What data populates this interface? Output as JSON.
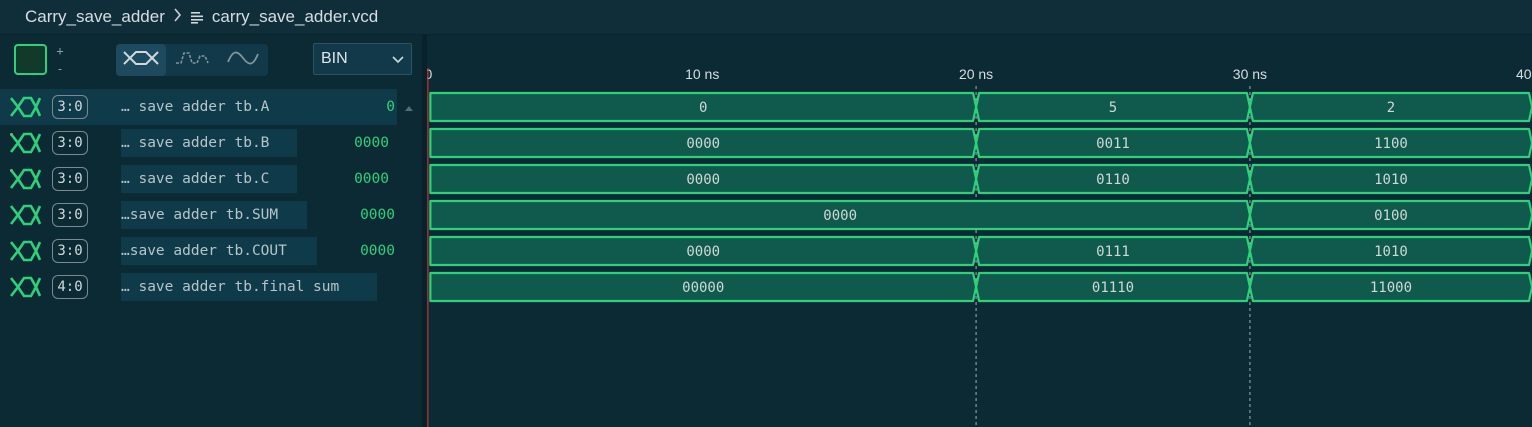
{
  "breadcrumb": {
    "root": "Carry_save_adder",
    "file": "carry_save_adder.vcd"
  },
  "toolbar": {
    "swatch_color": "#2fd07a",
    "swatch_plus": "+",
    "swatch_minus": "-",
    "shape_buttons": [
      "bus-shape-icon",
      "step-shape-icon",
      "analog-shape-icon"
    ],
    "format_value": "BIN"
  },
  "signals": [
    {
      "width": "3:0",
      "name": "… save adder tb.A",
      "value": "0"
    },
    {
      "width": "3:0",
      "name": "… save adder tb.B",
      "value": "0000"
    },
    {
      "width": "3:0",
      "name": "… save adder tb.C",
      "value": "0000"
    },
    {
      "width": "3:0",
      "name": "…save adder tb.SUM",
      "value": "0000"
    },
    {
      "width": "3:0",
      "name": "…save adder tb.COUT",
      "value": "0000"
    },
    {
      "width": "4:0",
      "name": "… save adder tb.final sum",
      "value": ""
    }
  ],
  "timeline": {
    "unit": "ns",
    "ticks": [
      0,
      10,
      20,
      30,
      40
    ],
    "tick_labels": [
      "0",
      "10 ns",
      "20 ns",
      "30 ns",
      "40"
    ],
    "view_start": -0.05,
    "view_end": 40.3,
    "markers": [
      20,
      30
    ]
  },
  "waves": [
    {
      "segments": [
        {
          "t0": 0,
          "t1": 20,
          "v": "0"
        },
        {
          "t0": 20,
          "t1": 30,
          "v": "5"
        },
        {
          "t0": 30,
          "t1": 40.3,
          "v": "2"
        }
      ]
    },
    {
      "segments": [
        {
          "t0": 0,
          "t1": 20,
          "v": "0000"
        },
        {
          "t0": 20,
          "t1": 30,
          "v": "0011"
        },
        {
          "t0": 30,
          "t1": 40.3,
          "v": "1100"
        }
      ]
    },
    {
      "segments": [
        {
          "t0": 0,
          "t1": 20,
          "v": "0000"
        },
        {
          "t0": 20,
          "t1": 30,
          "v": "0110"
        },
        {
          "t0": 30,
          "t1": 40.3,
          "v": "1010"
        }
      ]
    },
    {
      "segments": [
        {
          "t0": 0,
          "t1": 30,
          "v": "0000"
        },
        {
          "t0": 30,
          "t1": 40.3,
          "v": "0100"
        }
      ]
    },
    {
      "segments": [
        {
          "t0": 0,
          "t1": 20,
          "v": "0000"
        },
        {
          "t0": 20,
          "t1": 30,
          "v": "0111"
        },
        {
          "t0": 30,
          "t1": 40.3,
          "v": "1010"
        }
      ]
    },
    {
      "segments": [
        {
          "t0": 0,
          "t1": 20,
          "v": "00000"
        },
        {
          "t0": 20,
          "t1": 30,
          "v": "01110"
        },
        {
          "t0": 30,
          "t1": 40.3,
          "v": "11000"
        }
      ]
    }
  ],
  "colors": {
    "wave_stroke": "#2fd07a",
    "wave_fill": "#0f5a4c",
    "cursor": "#c0392b",
    "marker": "#9fb3b8"
  }
}
